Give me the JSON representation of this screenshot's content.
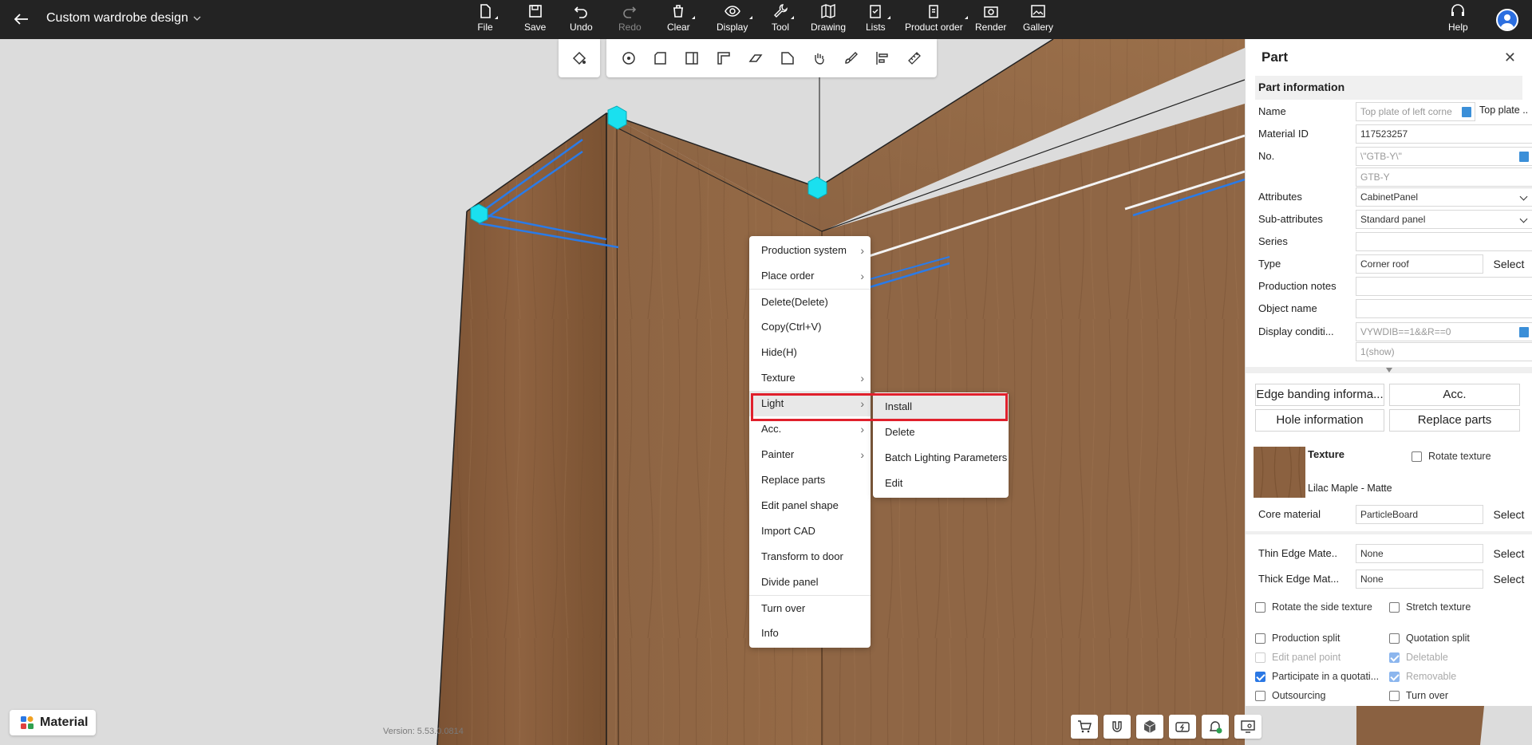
{
  "app": {
    "title": "Custom wardrobe design",
    "version": "Version: 5.53.0.0814"
  },
  "toolbar": {
    "items": [
      {
        "label": "File",
        "icon": "file-icon"
      },
      {
        "label": "Save",
        "icon": "save-icon"
      },
      {
        "label": "Undo",
        "icon": "undo-icon"
      },
      {
        "label": "Redo",
        "icon": "redo-icon"
      },
      {
        "label": "Clear",
        "icon": "clear-icon"
      },
      {
        "label": "Display",
        "icon": "eye-icon"
      },
      {
        "label": "Tool",
        "icon": "wrench-icon"
      },
      {
        "label": "Drawing",
        "icon": "map-icon"
      },
      {
        "label": "Lists",
        "icon": "clipboard-icon"
      },
      {
        "label": "Product order",
        "icon": "order-icon"
      },
      {
        "label": "Render",
        "icon": "camera-icon"
      },
      {
        "label": "Gallery",
        "icon": "gallery-icon"
      }
    ],
    "help": "Help"
  },
  "context_menu": {
    "items": [
      {
        "label": "Production system",
        "submenu": true
      },
      {
        "label": "Place order",
        "submenu": true
      },
      {
        "label": "Delete(Delete)",
        "submenu": false
      },
      {
        "label": "Copy(Ctrl+V)",
        "submenu": false
      },
      {
        "label": "Hide(H)",
        "submenu": false
      },
      {
        "label": "Texture",
        "submenu": true
      },
      {
        "label": "Light",
        "submenu": true
      },
      {
        "label": "Acc.",
        "submenu": true
      },
      {
        "label": "Painter",
        "submenu": true
      },
      {
        "label": "Replace parts",
        "submenu": false
      },
      {
        "label": "Edit panel shape",
        "submenu": false
      },
      {
        "label": "Import CAD",
        "submenu": false
      },
      {
        "label": "Transform to door",
        "submenu": false
      },
      {
        "label": "Divide panel",
        "submenu": false
      },
      {
        "label": "Turn over",
        "submenu": false
      },
      {
        "label": "Info",
        "submenu": false
      }
    ],
    "light_submenu": [
      "Install",
      "Delete",
      "Batch Lighting Parameters",
      "Edit"
    ]
  },
  "panel": {
    "title": "Part",
    "section": "Part information",
    "name_label": "Name",
    "name_value": "Top plate of left corne",
    "name_extra": "Top plate ...",
    "material_id_label": "Material ID",
    "material_id_value": "117523257",
    "no_label": "No.",
    "no_value": "\\\"GTB-Y\\\"",
    "no_value2": "GTB-Y",
    "attributes_label": "Attributes",
    "attributes_value": "CabinetPanel",
    "subattr_label": "Sub-attributes",
    "subattr_value": "Standard panel",
    "series_label": "Series",
    "type_label": "Type",
    "type_value": "Corner roof",
    "select": "Select",
    "prodnotes_label": "Production notes",
    "objname_label": "Object name",
    "display_label": "Display conditi...",
    "display_value": "VYWDIB==1&&R==0",
    "display_value2": "1(show)",
    "btn_edge": "Edge banding informa...",
    "btn_acc": "Acc.",
    "btn_hole": "Hole information",
    "btn_replace": "Replace parts",
    "texture_label": "Texture",
    "texture_name": "Lilac Maple - Matte",
    "rotate_texture": "Rotate texture",
    "core_label": "Core material",
    "core_value": "ParticleBoard",
    "thin_label": "Thin Edge Mate...",
    "thin_value": "None",
    "thick_label": "Thick Edge Mat...",
    "thick_value": "None",
    "checks": [
      {
        "label": "Rotate the side texture",
        "checked": false,
        "disabled": false
      },
      {
        "label": "Stretch texture",
        "checked": false,
        "disabled": false
      },
      {
        "label": "Production split",
        "checked": false,
        "disabled": false
      },
      {
        "label": "Quotation split",
        "checked": false,
        "disabled": false
      },
      {
        "label": "Edit panel point",
        "checked": false,
        "disabled": true
      },
      {
        "label": "Deletable",
        "checked": true,
        "disabled": true
      },
      {
        "label": "Participate in a quotati...",
        "checked": true,
        "disabled": false
      },
      {
        "label": "Removable",
        "checked": true,
        "disabled": true
      },
      {
        "label": "Outsourcing",
        "checked": false,
        "disabled": false
      },
      {
        "label": "Turn over",
        "checked": false,
        "disabled": false
      }
    ]
  },
  "bottom": {
    "material": "Material"
  },
  "colors": {
    "topbar": "#232323",
    "wood": "#8a5f3b",
    "highlight": "#e0202c",
    "accent": "#2b78e4",
    "handle": "#19e0ee"
  }
}
